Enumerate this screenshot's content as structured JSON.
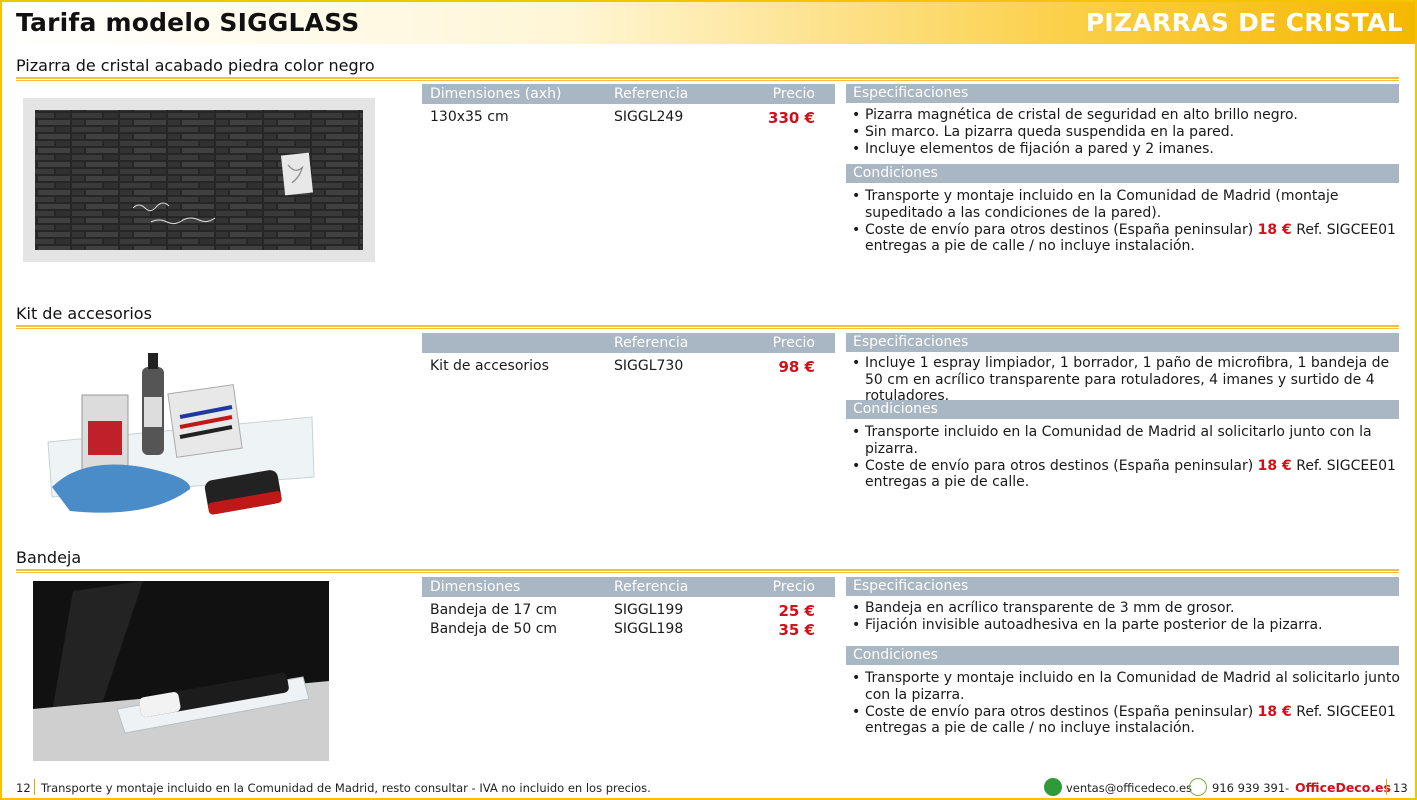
{
  "header": {
    "title": "Tarifa modelo SIGGLASS",
    "category": "PIZARRAS DE CRISTAL"
  },
  "colors": {
    "accent_yellow": "#f5c400",
    "price_red": "#d0101a",
    "table_header": "#a9b6c3"
  },
  "sections": [
    {
      "title": "Pizarra de cristal acabado piedra color negro",
      "columns": {
        "dim": "Dimensiones (axh)",
        "ref": "Referencia",
        "price": "Precio"
      },
      "rows": [
        {
          "dim": "130x35 cm",
          "ref": "SIGGL249",
          "price": "330 €"
        }
      ],
      "spec_title": "Especificaciones",
      "specs": [
        "Pizarra magnética de cristal de seguridad en alto brillo negro.",
        "Sin marco. La pizarra queda suspendida en la pared.",
        "Incluye elementos de fijación a pared y 2 imanes."
      ],
      "cond_title": "Condiciones",
      "conditions": [
        {
          "text": "Transporte y montaje incluido en la Comunidad de Madrid (montaje supeditado a las condiciones de la pared)."
        },
        {
          "pre": "Coste de envío para otros destinos  (España peninsular) ",
          "highlight": "18 €",
          "post": " Ref. SIGCEE01 entregas a pie de calle / no incluye instalación."
        }
      ],
      "image_caption": "Don't forget Dr Müller | 19:00"
    },
    {
      "title": "Kit de accesorios",
      "columns": {
        "dim": "",
        "ref": "Referencia",
        "price": "Precio"
      },
      "rows": [
        {
          "dim": "Kit de accesorios",
          "ref": "SIGGL730",
          "price": "98 €"
        }
      ],
      "spec_title": "Especificaciones",
      "specs": [
        "Incluye 1 espray limpiador, 1 borrador, 1 paño de microfibra, 1 bandeja de 50 cm en acrílico transparente para rotuladores, 4 imanes y surtido de 4 rotuladores."
      ],
      "cond_title": "Condiciones",
      "conditions": [
        {
          "text": "Transporte incluido en la Comunidad de Madrid al solicitarlo junto con la pizarra."
        },
        {
          "pre": "Coste de envío para otros destinos  (España peninsular) ",
          "highlight": "18 €",
          "post": " Ref. SIGCEE01 entregas a pie de calle."
        }
      ]
    },
    {
      "title": "Bandeja",
      "columns": {
        "dim": "Dimensiones",
        "ref": "Referencia",
        "price": "Precio"
      },
      "rows": [
        {
          "dim": "Bandeja de 17 cm",
          "ref": "SIGGL199",
          "price": "25 €"
        },
        {
          "dim": "Bandeja de 50 cm",
          "ref": "SIGGL198",
          "price": "35 €"
        }
      ],
      "spec_title": "Especificaciones",
      "specs": [
        "Bandeja en acrílico transparente de 3 mm de grosor.",
        "Fijación invisible autoadhesiva en la parte posterior de la pizarra."
      ],
      "cond_title": "Condiciones",
      "conditions": [
        {
          "text": "Transporte y montaje incluido en la Comunidad de Madrid al solicitarlo junto con la pizarra."
        },
        {
          "pre": "Coste de envío para otros destinos  (España peninsular) ",
          "highlight": "18 €",
          "post": " Ref. SIGCEE01 entregas a pie de calle / no incluye instalación."
        }
      ]
    }
  ],
  "footer": {
    "page_left": "12",
    "note": "Transporte y montaje incluido en la Comunidad de Madrid, resto consultar - IVA no incluido en los precios.",
    "email": "ventas@officedeco.es",
    "phone": "916 939 391",
    "dash": "-",
    "brand": "OfficeDeco.es",
    "page_right": "13"
  }
}
